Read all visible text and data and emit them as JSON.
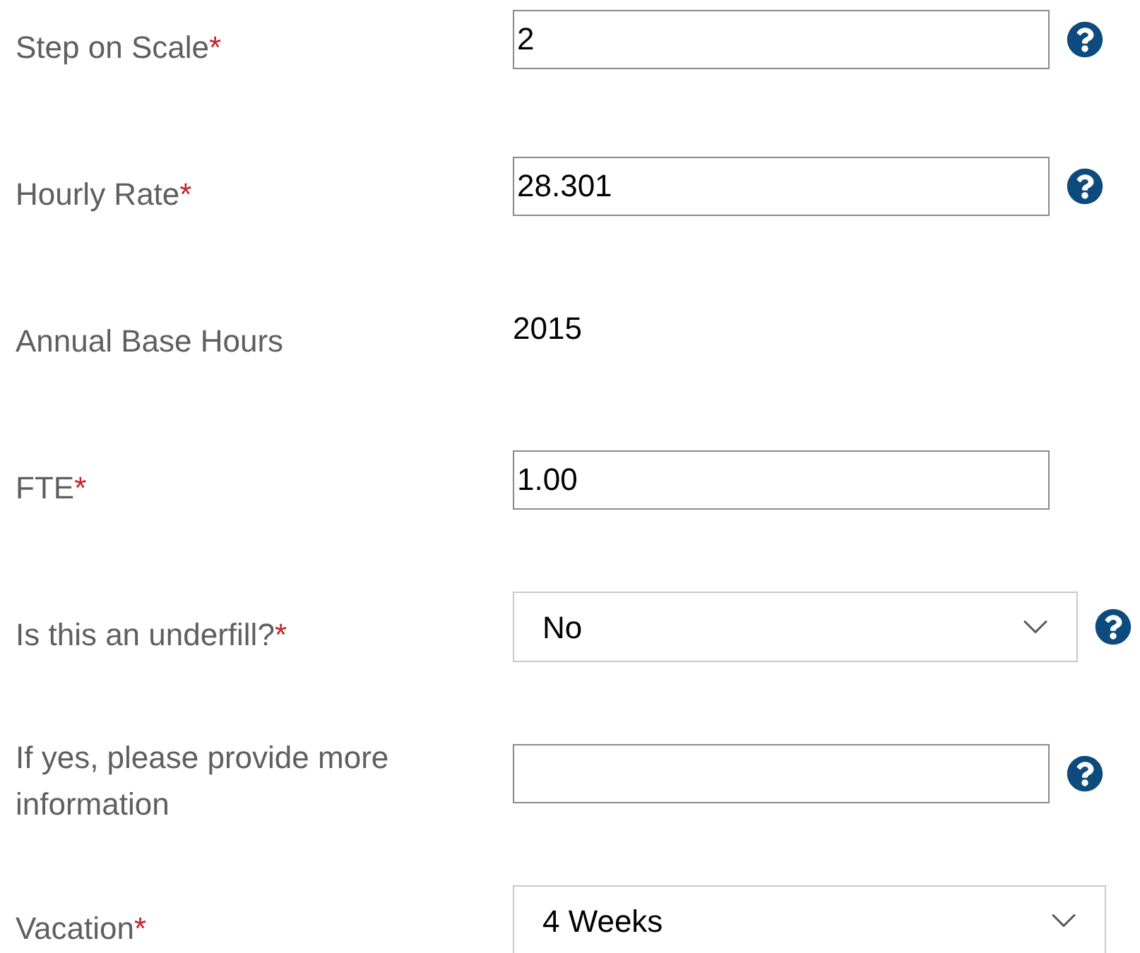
{
  "fields": [
    {
      "kind": "input",
      "label": "Step on Scale",
      "required_mark": "*",
      "value": "2",
      "help": true
    },
    {
      "kind": "input",
      "label": "Hourly Rate",
      "required_mark": "*",
      "value": "28.301",
      "help": true
    },
    {
      "kind": "text",
      "label": "Annual Base Hours",
      "value": "2015",
      "help": false
    },
    {
      "kind": "input",
      "label": "FTE",
      "required_mark": "*",
      "value": "1.00",
      "help": false
    },
    {
      "kind": "select",
      "label": "Is this an underfill?",
      "required_mark": "*",
      "value": "No",
      "help": true
    },
    {
      "kind": "input",
      "label": "If yes, please provide more information",
      "help": true
    },
    {
      "kind": "select",
      "label": "Vacation",
      "required_mark": "*",
      "value": "4 Weeks",
      "help": false
    }
  ]
}
